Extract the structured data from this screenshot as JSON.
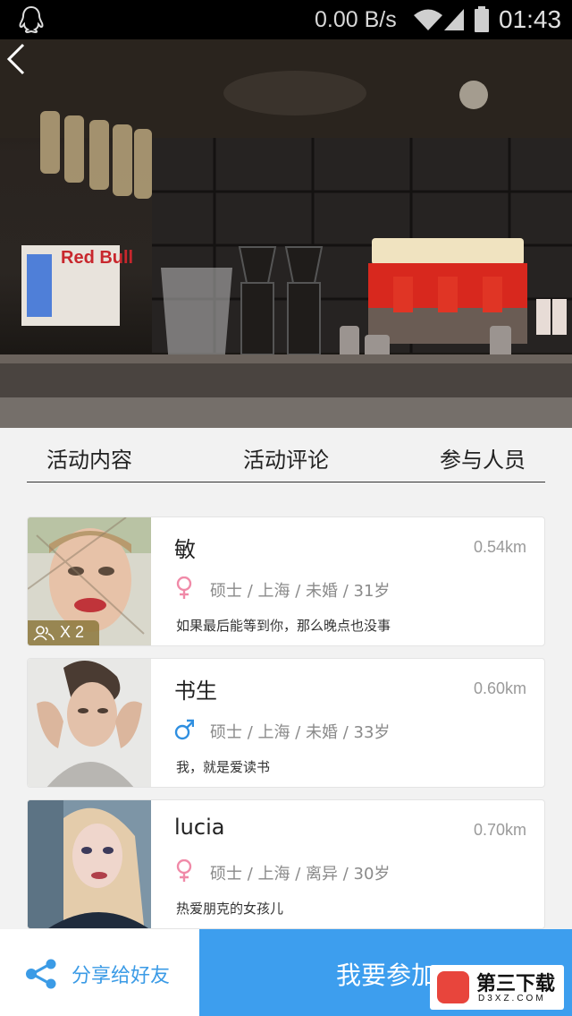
{
  "status_bar": {
    "speed": "0.00 B/s",
    "time": "01:43"
  },
  "tabs": [
    {
      "label": "活动内容"
    },
    {
      "label": "活动评论"
    },
    {
      "label": "参与人员"
    }
  ],
  "participants": [
    {
      "name": "敏",
      "distance": "0.54km",
      "gender": "female",
      "info": "硕士 / 上海  / 未婚 / 31岁",
      "motto": "如果最后能等到你，那么晚点也没事",
      "badge": "X 2"
    },
    {
      "name": "书生",
      "distance": "0.60km",
      "gender": "male",
      "info": "硕士 / 上海  / 未婚 / 33岁",
      "motto": "我，就是爱读书"
    },
    {
      "name": "lucia",
      "distance": "0.70km",
      "gender": "female",
      "info": "硕士 / 上海  / 离异 / 30岁",
      "motto": "热爱朋克的女孩儿"
    }
  ],
  "bottom_bar": {
    "share_label": "分享给好友",
    "join_label": "我要参加"
  },
  "watermark": {
    "title": "第三下载",
    "sub": "D3XZ.COM"
  },
  "colors": {
    "accent": "#3d9eee",
    "female": "#f08aa8",
    "male": "#2f8fe0"
  }
}
